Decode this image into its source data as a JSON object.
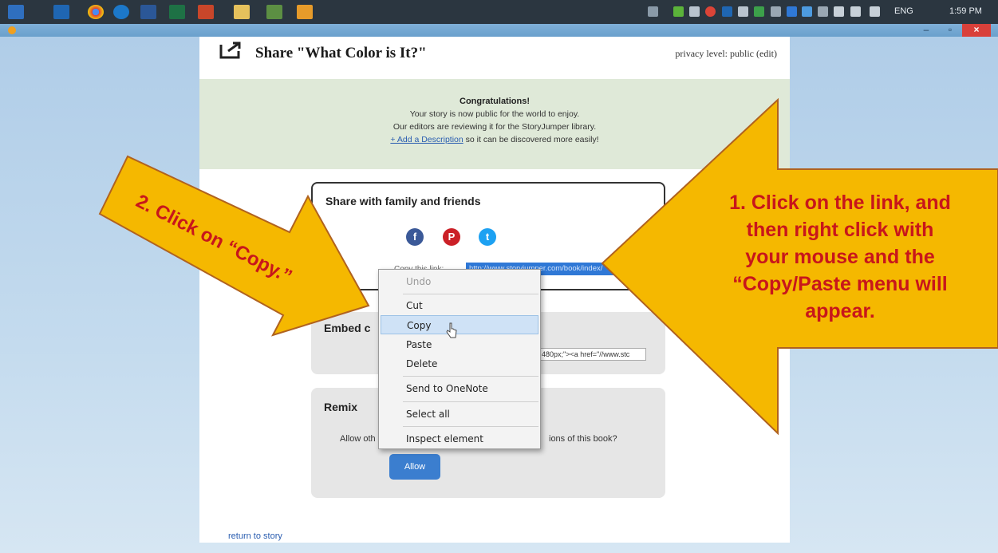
{
  "taskbar": {
    "language": "ENG",
    "clock": "1:59 PM"
  },
  "window": {
    "minimize_label": "–",
    "restore_label": "▫",
    "close_label": "×"
  },
  "page": {
    "title": "Share \"What Color is It?\"",
    "privacy": "privacy level: public (edit)",
    "congrats": {
      "heading": "Congratulations!",
      "line1": "Your story is now public for the world to enjoy.",
      "line2": "Our editors are reviewing it for the StoryJumper library.",
      "link": "+ Add a Description",
      "line3_tail": " so it can be discovered more easily!"
    },
    "share": {
      "heading": "Share with family and friends",
      "copy_label": "Copy this link:",
      "link_value": "http://www.storyjumper.com/book/index/",
      "facebook": "f",
      "pinterest": "P",
      "twitter": "t"
    },
    "embed": {
      "heading": "Embed c",
      "field_value": "480px;\"><a href=\"//www.stc"
    },
    "remix": {
      "heading": "Remix",
      "question_start": "Allow oth",
      "question_end": "ions of this book?",
      "allow_button": "Allow"
    },
    "return_link": "return to story"
  },
  "context_menu": {
    "items": [
      {
        "label": "Undo"
      },
      {
        "label": "Cut"
      },
      {
        "label": "Copy"
      },
      {
        "label": "Paste"
      },
      {
        "label": "Delete"
      },
      {
        "label": "Send to OneNote"
      },
      {
        "label": "Select all"
      },
      {
        "label": "Inspect element"
      }
    ]
  },
  "callouts": {
    "left": "2. Click on “Copy.”",
    "right_lines": [
      "1. Click on the link, and",
      "then right click with",
      "your mouse and the",
      "“Copy/Paste menu will",
      "appear."
    ]
  },
  "colors": {
    "callout_fill": "#f5b800",
    "callout_stroke": "#b0621f",
    "callout_text": "#c8161b",
    "accent_blue": "#3b7ecf"
  }
}
